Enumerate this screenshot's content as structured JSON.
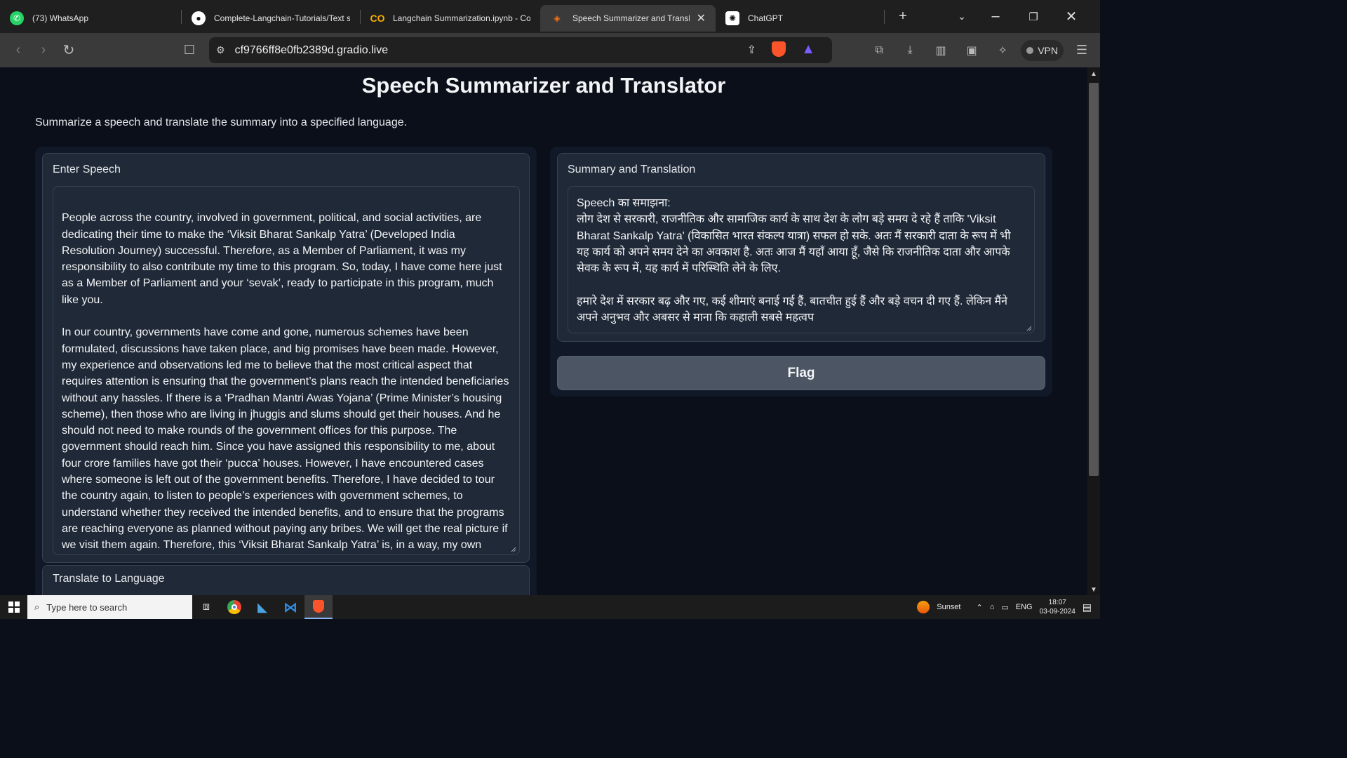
{
  "browser": {
    "tabs": [
      {
        "title": "(73) WhatsApp",
        "icon": "whatsapp-icon",
        "active": false
      },
      {
        "title": "Complete-Langchain-Tutorials/Text summariza",
        "icon": "github-icon",
        "active": false
      },
      {
        "title": "Langchain Summarization.ipynb - Colab",
        "icon": "colab-icon",
        "active": false
      },
      {
        "title": "Speech Summarizer and Translator",
        "icon": "gradio-icon",
        "active": true
      },
      {
        "title": "ChatGPT",
        "icon": "chatgpt-icon",
        "active": false
      }
    ],
    "url": "cf9766ff8e0fb2389d.gradio.live",
    "vpn_label": "VPN"
  },
  "page": {
    "title": "Speech Summarizer and Translator",
    "description": "Summarize a speech and translate the summary into a specified language.",
    "input": {
      "label": "Enter Speech",
      "value": "\nPeople across the country, involved in government, political, and social activities, are dedicating their time to make the ‘Viksit Bharat Sankalp Yatra’ (Developed India Resolution Journey) successful. Therefore, as a Member of Parliament, it was my responsibility to also contribute my time to this program. So, today, I have come here just as a Member of Parliament and your ‘sevak’, ready to participate in this program, much like you.\n\nIn our country, governments have come and gone, numerous schemes have been formulated, discussions have taken place, and big promises have been made. However, my experience and observations led me to believe that the most critical aspect that requires attention is ensuring that the government’s plans reach the intended beneficiaries without any hassles. If there is a ‘Pradhan Mantri Awas Yojana’ (Prime Minister’s housing scheme), then those who are living in jhuggis and slums should get their houses. And he should not need to make rounds of the government offices for this purpose. The government should reach him. Since you have assigned this responsibility to me, about four crore families have got their ‘pucca’ houses. However, I have encountered cases where someone is left out of the government benefits. Therefore, I have decided to tour the country again, to listen to people’s experiences with government schemes, to understand whether they received the intended benefits, and to ensure that the programs are reaching everyone as planned without paying any bribes. We will get the real picture if we visit them again. Therefore, this ‘Viksit Bharat Sankalp Yatra’ is, in a way, my own examination. I want to hear from you and the people across the country whether what I envisioned and the work I have been doing"
    },
    "language_label": "Translate to Language",
    "output": {
      "label": "Summary and Translation",
      "value": "Speech का समाझना:\nलोग देश से सरकारी, राजनीतिक और सामाजिक कार्य के साथ देश के लोग बड़े समय दे रहे हैं ताकि 'Viksit Bharat Sankalp Yatra' (विकासित भारत संकल्प यात्रा) सफल हो सके. अतः मैं सरकारी दाता के रूप में भी यह कार्य को अपने समय देने का अवकाश है. अतः आज मैं यहाँ आया हूँ, जैसे कि राजनीतिक दाता और आपके सेवक के रूप में, यह कार्य में परिस्थिति लेने के लिए.\n\nहमारे देश में सरकार बढ़ और गए, कई शीमाएं बनाई गई हैं, बातचीत हुई हैं और बड़े वचन दी गए हैं. लेकिन मैंने अपने अनुभव और अबसर से माना कि कहाली सबसे महत्वप"
    },
    "flag_label": "Flag"
  },
  "taskbar": {
    "search_placeholder": "Type here to search",
    "weather": "Sunset",
    "language": "ENG",
    "time": "18:07",
    "date": "03-09-2024"
  }
}
